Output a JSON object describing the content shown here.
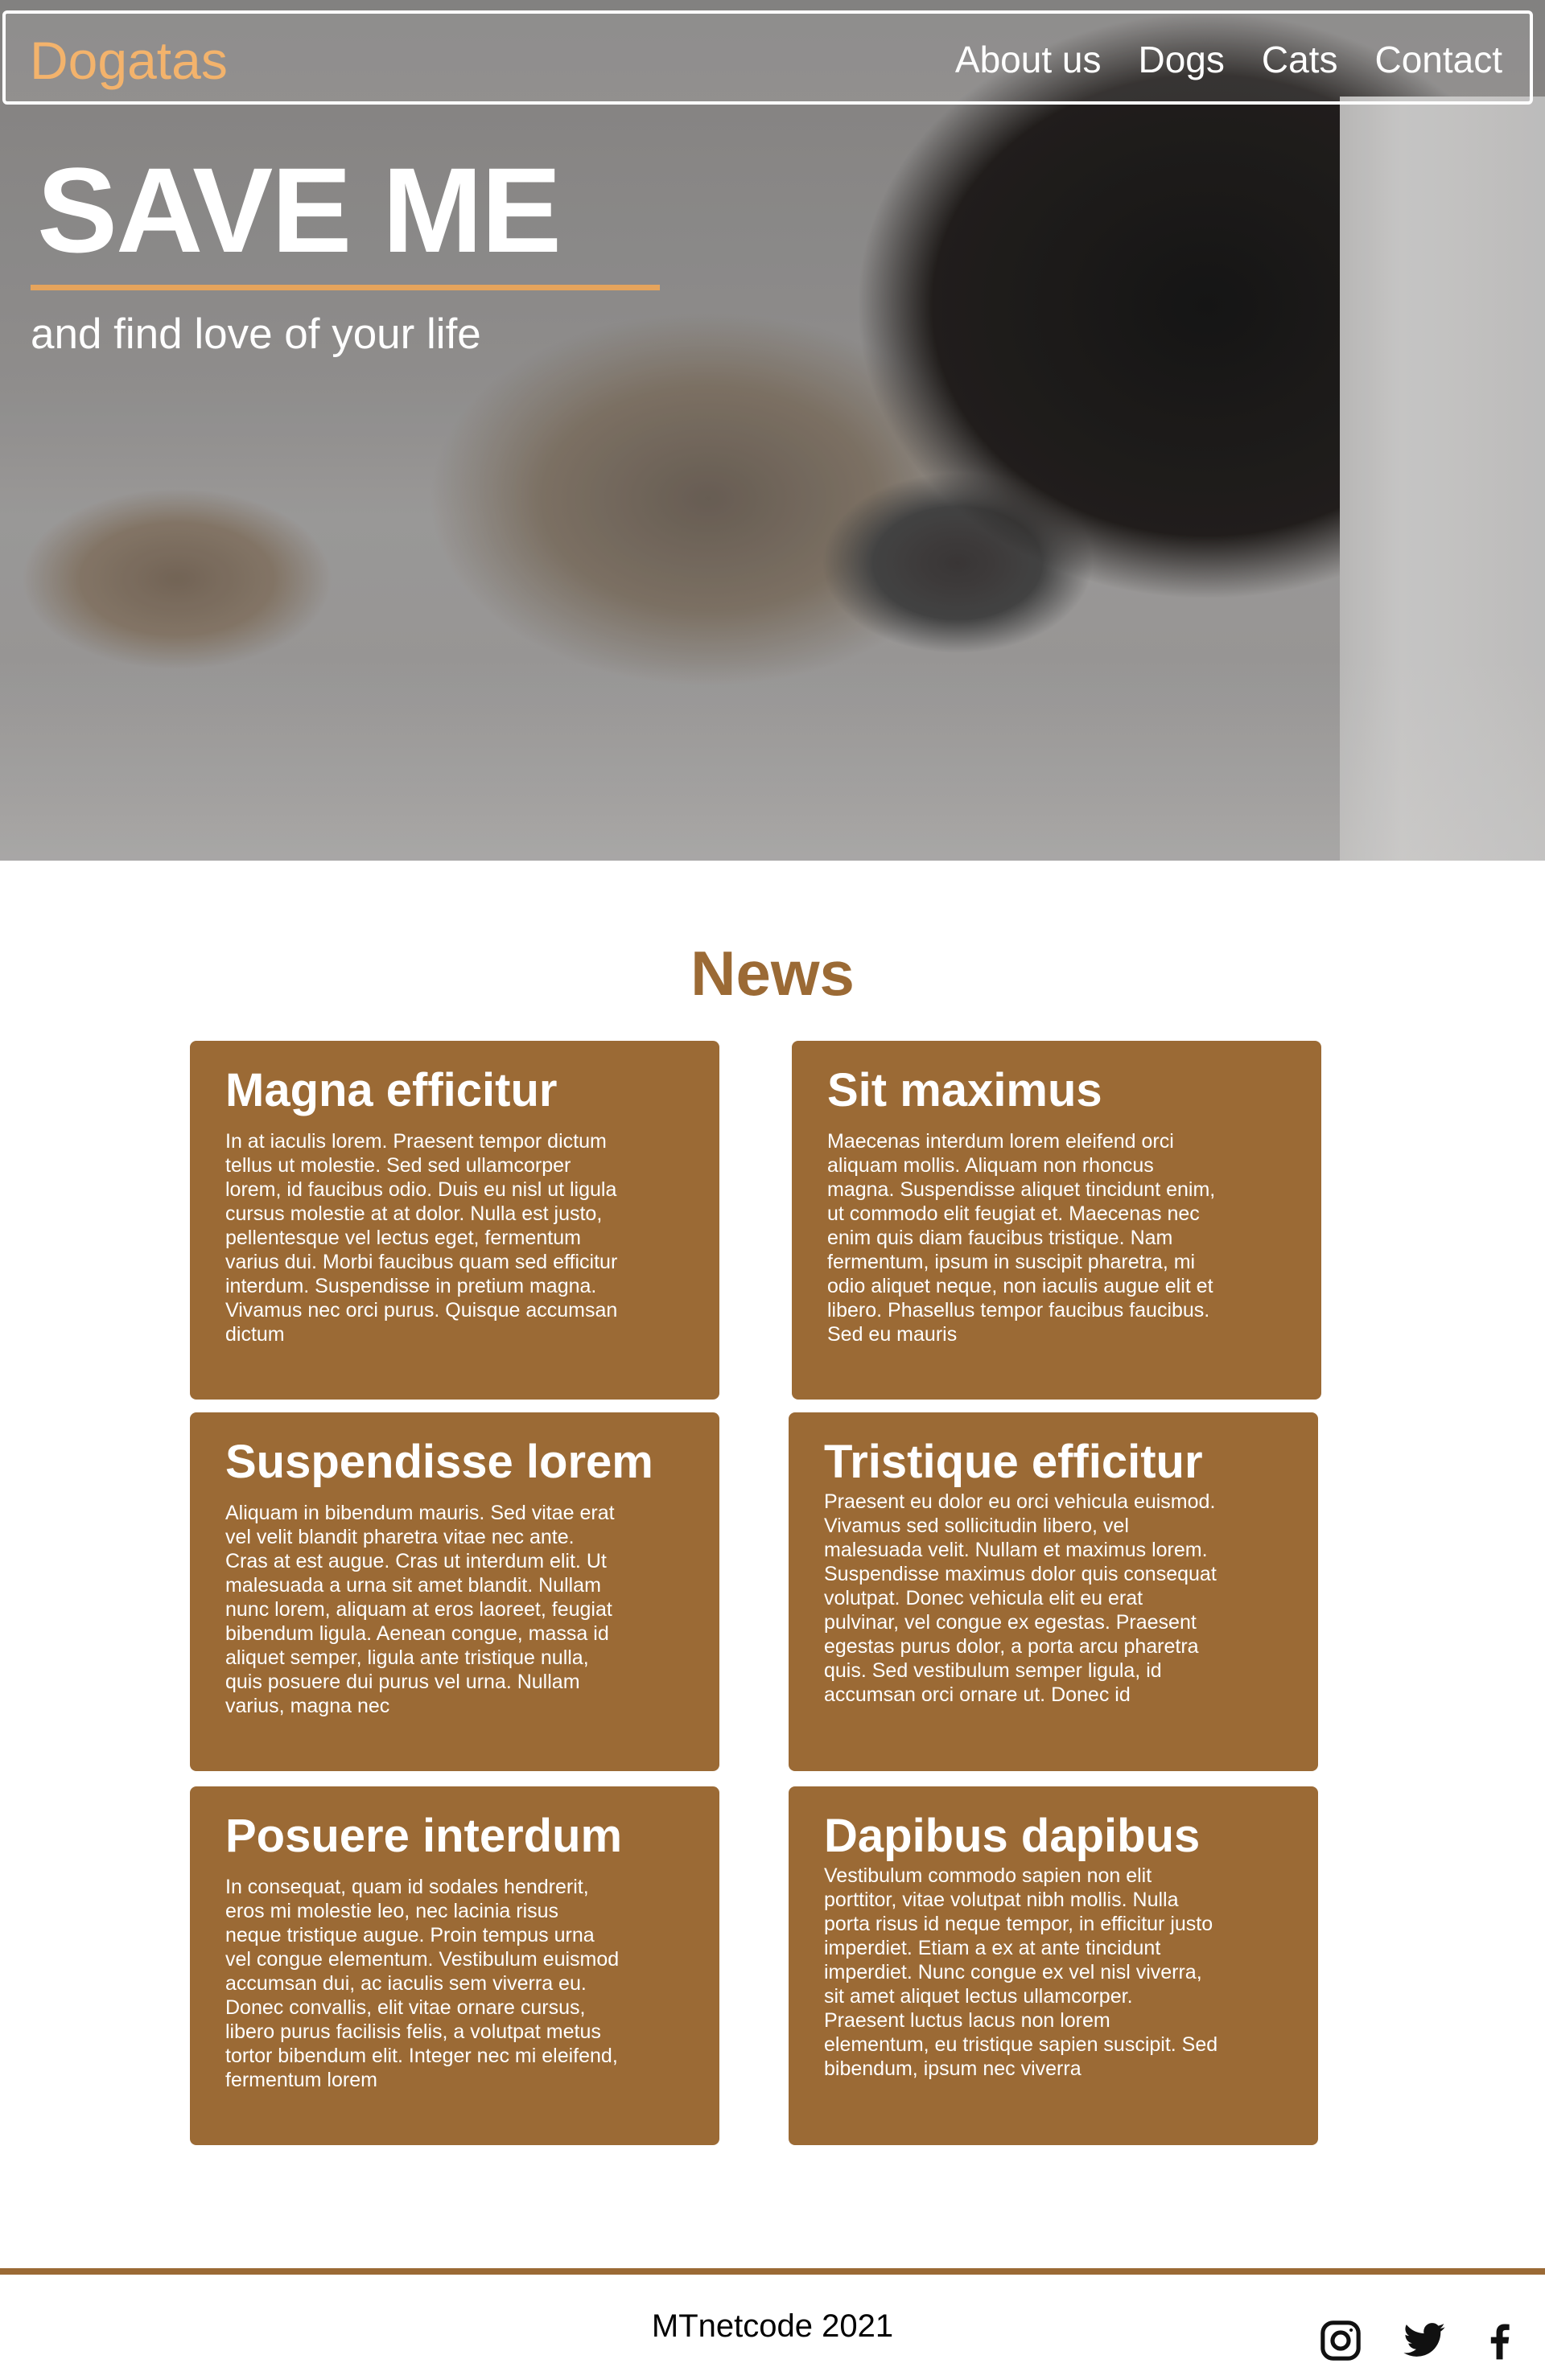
{
  "brand": {
    "logo": "Dogatas",
    "accent": "#f3b36c"
  },
  "nav": {
    "items": [
      {
        "label": "About us"
      },
      {
        "label": "Dogs"
      },
      {
        "label": "Cats"
      },
      {
        "label": "Contact"
      }
    ]
  },
  "hero": {
    "title": "SAVE ME",
    "subtitle": "and find love of your life",
    "underline_color": "#e6a45c"
  },
  "news": {
    "heading": "News",
    "card_color": "#9b6a35",
    "cards": [
      {
        "title": "Magna efficitur",
        "body": "In at iaculis lorem. Praesent tempor dictum tellus ut molestie. Sed sed ullamcorper lorem, id faucibus odio. Duis eu nisl ut ligula cursus molestie at at dolor. Nulla est justo, pellentesque vel lectus eget, fermentum varius dui. Morbi faucibus quam sed efficitur interdum. Suspendisse in pretium magna. Vivamus nec orci purus. Quisque accumsan dictum"
      },
      {
        "title": "Sit maximus",
        "body": "Maecenas interdum lorem eleifend orci aliquam mollis. Aliquam non rhoncus magna. Suspendisse aliquet tincidunt enim, ut commodo elit feugiat et. Maecenas nec enim quis diam faucibus tristique. Nam fermentum, ipsum in suscipit pharetra, mi odio aliquet neque, non iaculis augue elit et libero. Phasellus tempor faucibus faucibus. Sed eu mauris"
      },
      {
        "title": "Suspendisse lorem",
        "body": "Aliquam in bibendum mauris. Sed vitae erat vel velit blandit pharetra vitae nec ante. Cras at est augue. Cras ut interdum elit. Ut malesuada a urna sit amet blandit. Nullam nunc lorem, aliquam at eros laoreet, feugiat bibendum ligula. Aenean congue, massa id aliquet semper, ligula ante tristique nulla, quis posuere dui purus vel urna. Nullam varius, magna nec"
      },
      {
        "title": "Tristique efficitur",
        "body": "Praesent eu dolor eu orci vehicula euismod. Vivamus sed sollicitudin libero, vel malesuada velit. Nullam et maximus lorem. Suspendisse maximus dolor quis consequat volutpat. Donec vehicula elit eu erat pulvinar, vel congue ex egestas. Praesent egestas purus dolor, a porta arcu pharetra quis. Sed vestibulum semper ligula, id accumsan orci ornare ut. Donec id"
      },
      {
        "title": "Posuere interdum",
        "body": "In consequat, quam id sodales hendrerit, eros mi molestie leo, nec lacinia risus neque tristique augue. Proin tempus urna vel congue elementum. Vestibulum euismod accumsan dui, ac iaculis sem viverra eu. Donec convallis, elit vitae ornare cursus, libero purus facilisis felis, a volutpat metus tortor bibendum elit. Integer nec mi eleifend, fermentum lorem"
      },
      {
        "title": "Dapibus dapibus",
        "body": "Vestibulum commodo sapien non elit porttitor, vitae volutpat nibh mollis. Nulla porta risus id neque tempor, in efficitur justo imperdiet. Etiam a ex at ante tincidunt imperdiet. Nunc congue ex vel nisl viverra, sit amet aliquet lectus ullamcorper. Praesent luctus lacus non lorem elementum, eu tristique sapien suscipit. Sed bibendum, ipsum nec viverra"
      }
    ]
  },
  "footer": {
    "text": "MTnetcode 2021",
    "social": [
      "instagram-icon",
      "twitter-icon",
      "facebook-icon"
    ]
  }
}
